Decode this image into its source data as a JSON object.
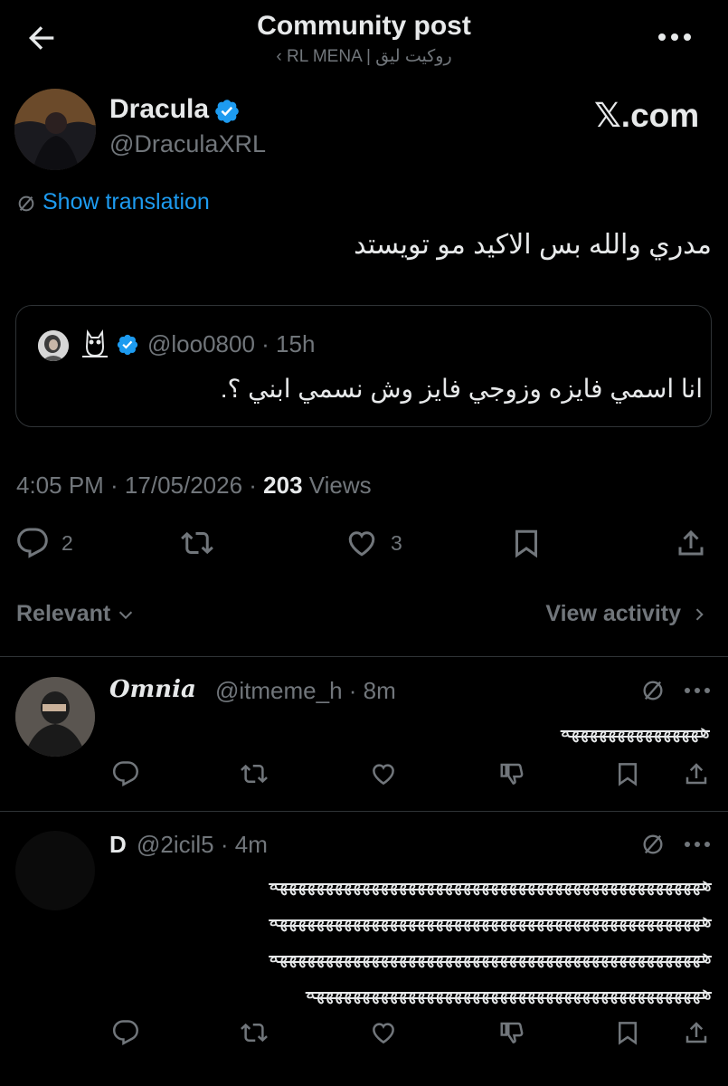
{
  "header": {
    "title": "Community post",
    "subtitle": "‹ RL MENA | روكيت ليق"
  },
  "post": {
    "author_name": "Dracula",
    "author_handle": "@DraculaXRL",
    "watermark": "𝕏.com",
    "translate_label": "Show translation",
    "text": "مدري والله بس الاكيد مو تويستد",
    "quote": {
      "handle_time": "@loo0800 · 15h",
      "text": "انا اسمي فايزه وزوجي فايز وش نسمي ابني ؟."
    },
    "time": "4:05 PM · 17/05/2026 · ",
    "views_count": "203",
    "views_label": " Views",
    "actions": {
      "replies": "2",
      "reposts": "",
      "likes": "3"
    }
  },
  "sort": {
    "label": "Relevant",
    "activity_label": "View activity"
  },
  "replies": [
    {
      "name": "𝑶𝒎𝒏𝒊𝒂",
      "handle": "@itmeme_h · 8m",
      "text": "هههههههههههههههه"
    },
    {
      "name": "D",
      "handle": "@2icil5 · 4m",
      "lines": [
        "هههههههههههههههههههههههههههههههههههههههههههههههه",
        "هههههههههههههههههههههههههههههههههههههههههههههههه",
        "هههههههههههههههههههههههههههههههههههههههههههههههه",
        "هههههههههههههههههههههههههههههههههههههههههههه"
      ]
    }
  ],
  "colors": {
    "accent": "#1d9bf0",
    "secondary_text": "#71767b",
    "background": "#000000"
  }
}
